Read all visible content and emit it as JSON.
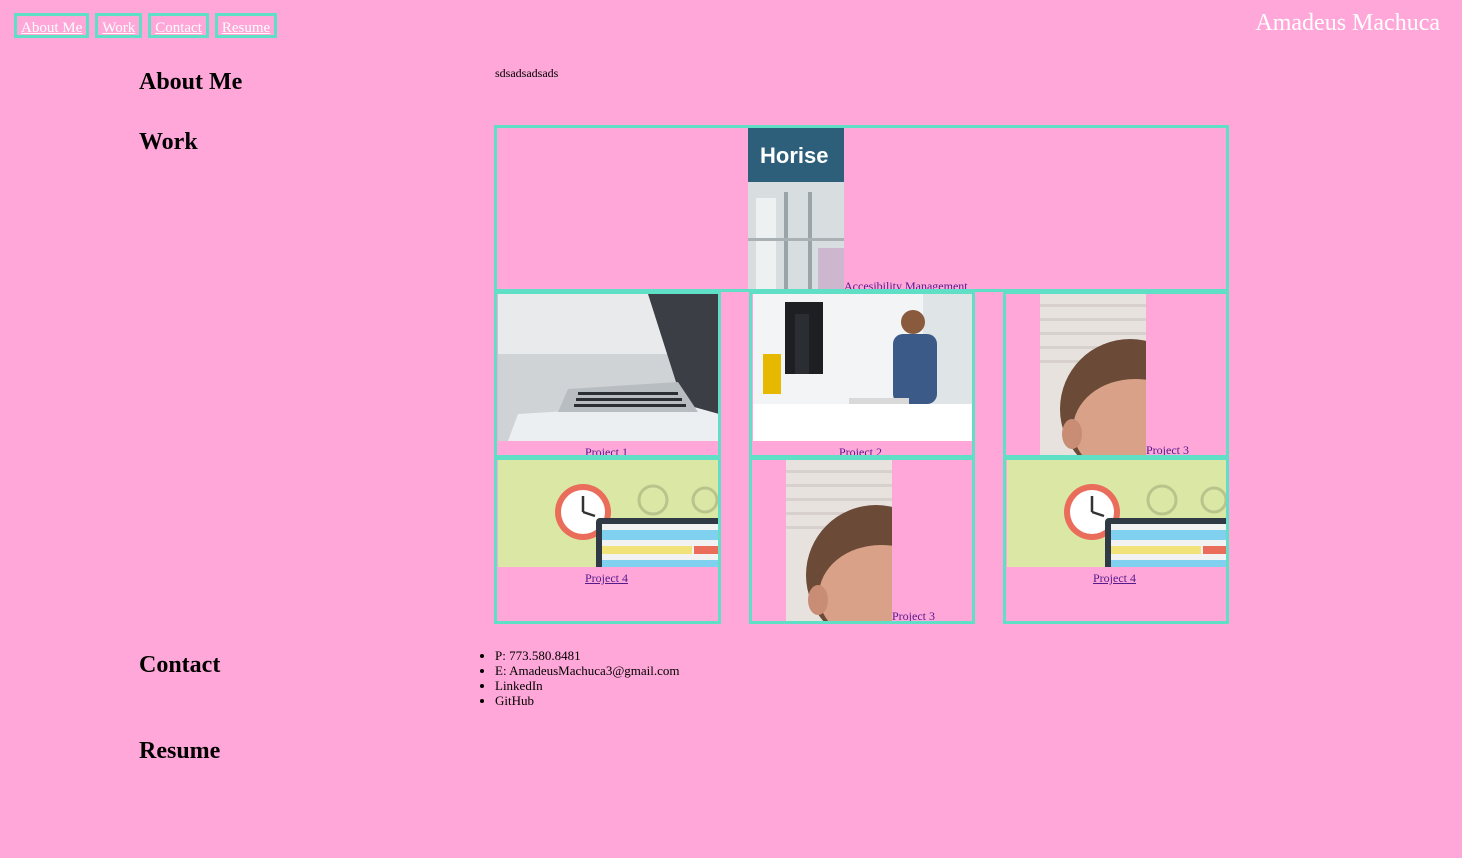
{
  "nav": {
    "items": [
      {
        "label": "About Me"
      },
      {
        "label": "Work"
      },
      {
        "label": "Contact"
      },
      {
        "label": "Resume"
      }
    ],
    "brand": "Amadeus Machuca"
  },
  "about": {
    "heading": "About Me",
    "text": "sdsadsadsads"
  },
  "work": {
    "heading": "Work",
    "featured": {
      "image_text": "Horise",
      "caption": "Accesibility Management"
    },
    "projects": [
      {
        "caption": "Project 1"
      },
      {
        "caption": "Project 2"
      },
      {
        "caption": "Project 3"
      },
      {
        "caption": "Project 4"
      },
      {
        "caption": "Project 3"
      },
      {
        "caption": "Project 4"
      }
    ]
  },
  "contact": {
    "heading": "Contact",
    "items": [
      {
        "text": "P: 773.580.8481"
      },
      {
        "text": "E: AmadeusMachuca3@gmail.com"
      },
      {
        "text": "LinkedIn"
      },
      {
        "text": "GitHub"
      }
    ]
  },
  "resume": {
    "heading": "Resume"
  },
  "colors": {
    "background": "#ffa7d9",
    "accent": "#5fe0c6",
    "link": "#551a8b",
    "white": "#ffffff"
  }
}
